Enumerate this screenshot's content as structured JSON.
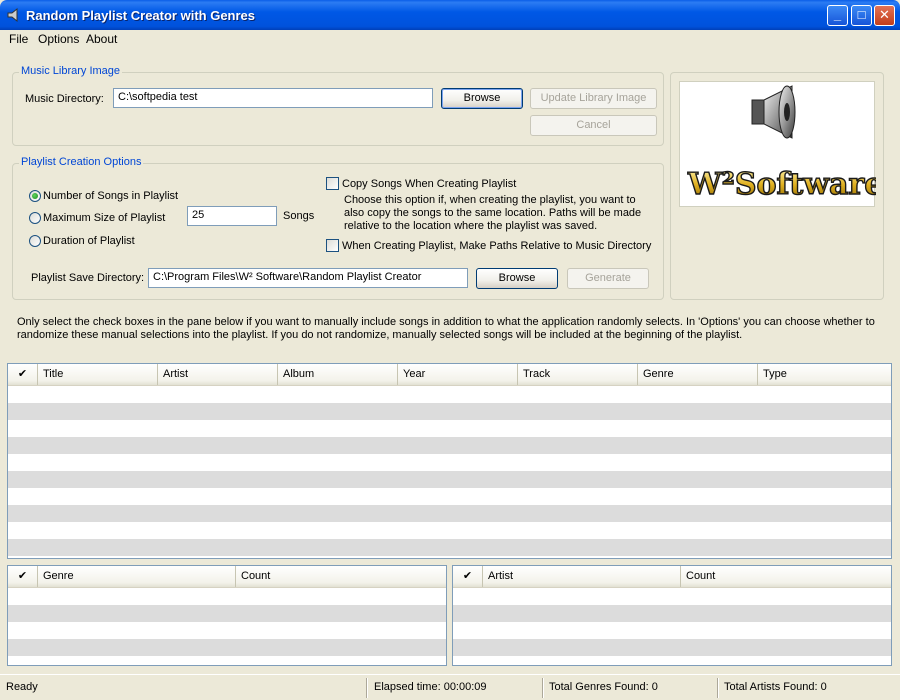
{
  "window": {
    "title": "Random Playlist Creator with Genres",
    "controls": {
      "minimize": "_",
      "maximize": "□",
      "close": "✕"
    }
  },
  "menu": [
    "File",
    "Options",
    "About"
  ],
  "music_library": {
    "legend": "Music Library Image",
    "dir_label": "Music Directory:",
    "dir_value": "C:\\softpedia test",
    "browse": "Browse",
    "update": "Update Library Image",
    "cancel": "Cancel"
  },
  "playlist_options": {
    "legend": "Playlist Creation Options",
    "radios": [
      {
        "label": "Number of Songs in Playlist",
        "checked": true
      },
      {
        "label": "Maximum Size of Playlist",
        "checked": false
      },
      {
        "label": "Duration of Playlist",
        "checked": false
      }
    ],
    "amount_value": "25",
    "amount_unit": "Songs",
    "copy_songs_label": "Copy Songs When Creating Playlist",
    "copy_songs_desc": [
      "Choose this option if, when creating the playlist, you want to",
      "also copy the songs to the same location.  Paths will be made",
      "relative to the location where the playlist was saved."
    ],
    "relative_paths_label": "When Creating Playlist, Make Paths Relative to Music Directory",
    "save_dir_label": "Playlist Save Directory:",
    "save_dir_value": "C:\\Program Files\\W² Software\\Random Playlist Creator",
    "browse": "Browse",
    "generate": "Generate"
  },
  "logo": {
    "text": "W²Software"
  },
  "instructions": [
    "Only select the check boxes in the pane below if you want to manually include songs in addition to what the application randomly selects.  In 'Options' you can choose whether to",
    "randomize these manual selections into the playlist.  If you do not randomize, manually selected songs will be included at the beginning of the playlist."
  ],
  "songs_list": {
    "columns": [
      "✔",
      "Title",
      "Artist",
      "Album",
      "Year",
      "Track",
      "Genre",
      "Type"
    ]
  },
  "genre_list": {
    "columns": [
      "✔",
      "Genre",
      "Count"
    ]
  },
  "artist_list": {
    "columns": [
      "✔",
      "Artist",
      "Count"
    ]
  },
  "status": {
    "ready": "Ready",
    "elapsed": "Elapsed time: 00:00:09",
    "genres": "Total Genres Found: 0",
    "artists": "Total Artists Found: 0"
  },
  "colors": {
    "titlebar": "#0058e6",
    "legend": "#0046d5",
    "window_bg": "#ece9d8"
  }
}
